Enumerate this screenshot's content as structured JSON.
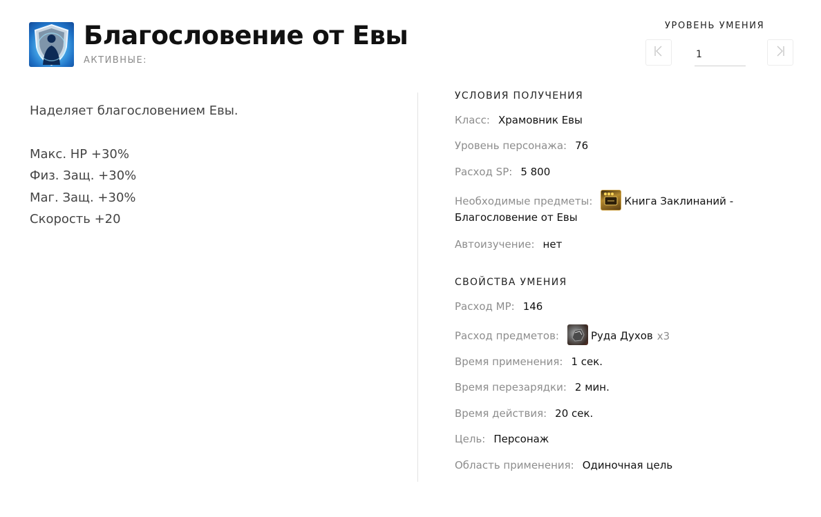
{
  "skill": {
    "title": "Благословение от Евы",
    "type": "АКТИВНЫЕ:",
    "icon": "shield-blessing-icon"
  },
  "level": {
    "title": "УРОВЕНЬ УМЕНИЯ",
    "value": "1",
    "first_icon": "first-page-icon",
    "last_icon": "last-page-icon"
  },
  "description": {
    "intro": "Наделяет благословением Евы.",
    "stats": [
      "Макс. HP +30%",
      "Физ. Защ. +30%",
      "Маг. Защ. +30%",
      "Скорость +20"
    ]
  },
  "conditions": {
    "title": "УСЛОВИЯ ПОЛУЧЕНИЯ",
    "class_label": "Класс:",
    "class_value": "Храмовник Евы",
    "char_level_label": "Уровень персонажа:",
    "char_level_value": "76",
    "sp_label": "Расход SP:",
    "sp_value": "5 800",
    "items_label": "Необходимые предметы:",
    "items_value_line1": "Книга Заклинаний -",
    "items_value_line2": "Благословение от Евы",
    "items_icon": "spellbook-icon",
    "auto_label": "Автоизучение:",
    "auto_value": "нет"
  },
  "properties": {
    "title": "СВОЙСТВА УМЕНИЯ",
    "mp_label": "Расход MP:",
    "mp_value": "146",
    "items_label": "Расход предметов:",
    "items_value": "Руда Духов",
    "items_qty": "x3",
    "items_icon": "spirit-ore-icon",
    "cast_label": "Время применения:",
    "cast_value": "1 сек.",
    "cooldown_label": "Время перезарядки:",
    "cooldown_value": "2 мин.",
    "duration_label": "Время действия:",
    "duration_value": "20 сек.",
    "target_label": "Цель:",
    "target_value": "Персонаж",
    "area_label": "Область применения:",
    "area_value": "Одиночная цель"
  }
}
